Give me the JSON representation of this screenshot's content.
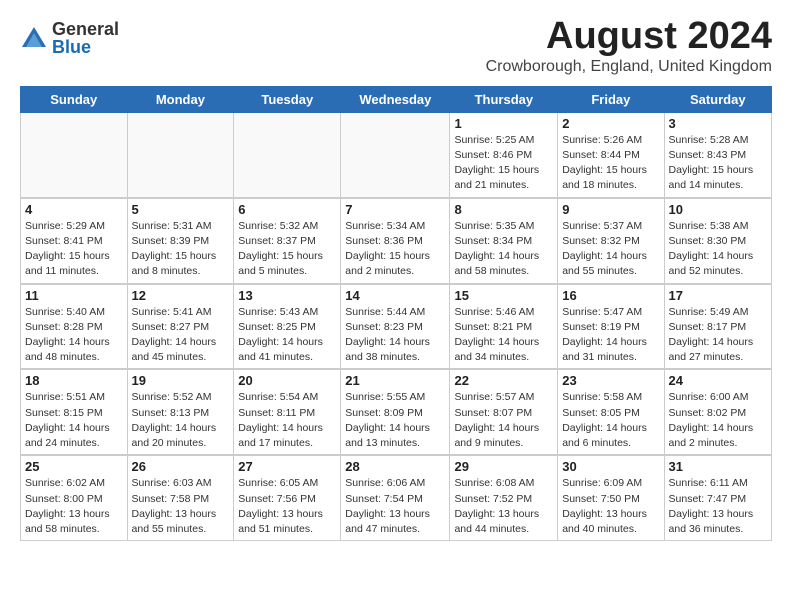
{
  "header": {
    "logo_general": "General",
    "logo_blue": "Blue",
    "month_title": "August 2024",
    "location": "Crowborough, England, United Kingdom"
  },
  "days_of_week": [
    "Sunday",
    "Monday",
    "Tuesday",
    "Wednesday",
    "Thursday",
    "Friday",
    "Saturday"
  ],
  "weeks": [
    [
      {
        "day": "",
        "info": ""
      },
      {
        "day": "",
        "info": ""
      },
      {
        "day": "",
        "info": ""
      },
      {
        "day": "",
        "info": ""
      },
      {
        "day": "1",
        "info": "Sunrise: 5:25 AM\nSunset: 8:46 PM\nDaylight: 15 hours\nand 21 minutes."
      },
      {
        "day": "2",
        "info": "Sunrise: 5:26 AM\nSunset: 8:44 PM\nDaylight: 15 hours\nand 18 minutes."
      },
      {
        "day": "3",
        "info": "Sunrise: 5:28 AM\nSunset: 8:43 PM\nDaylight: 15 hours\nand 14 minutes."
      }
    ],
    [
      {
        "day": "4",
        "info": "Sunrise: 5:29 AM\nSunset: 8:41 PM\nDaylight: 15 hours\nand 11 minutes."
      },
      {
        "day": "5",
        "info": "Sunrise: 5:31 AM\nSunset: 8:39 PM\nDaylight: 15 hours\nand 8 minutes."
      },
      {
        "day": "6",
        "info": "Sunrise: 5:32 AM\nSunset: 8:37 PM\nDaylight: 15 hours\nand 5 minutes."
      },
      {
        "day": "7",
        "info": "Sunrise: 5:34 AM\nSunset: 8:36 PM\nDaylight: 15 hours\nand 2 minutes."
      },
      {
        "day": "8",
        "info": "Sunrise: 5:35 AM\nSunset: 8:34 PM\nDaylight: 14 hours\nand 58 minutes."
      },
      {
        "day": "9",
        "info": "Sunrise: 5:37 AM\nSunset: 8:32 PM\nDaylight: 14 hours\nand 55 minutes."
      },
      {
        "day": "10",
        "info": "Sunrise: 5:38 AM\nSunset: 8:30 PM\nDaylight: 14 hours\nand 52 minutes."
      }
    ],
    [
      {
        "day": "11",
        "info": "Sunrise: 5:40 AM\nSunset: 8:28 PM\nDaylight: 14 hours\nand 48 minutes."
      },
      {
        "day": "12",
        "info": "Sunrise: 5:41 AM\nSunset: 8:27 PM\nDaylight: 14 hours\nand 45 minutes."
      },
      {
        "day": "13",
        "info": "Sunrise: 5:43 AM\nSunset: 8:25 PM\nDaylight: 14 hours\nand 41 minutes."
      },
      {
        "day": "14",
        "info": "Sunrise: 5:44 AM\nSunset: 8:23 PM\nDaylight: 14 hours\nand 38 minutes."
      },
      {
        "day": "15",
        "info": "Sunrise: 5:46 AM\nSunset: 8:21 PM\nDaylight: 14 hours\nand 34 minutes."
      },
      {
        "day": "16",
        "info": "Sunrise: 5:47 AM\nSunset: 8:19 PM\nDaylight: 14 hours\nand 31 minutes."
      },
      {
        "day": "17",
        "info": "Sunrise: 5:49 AM\nSunset: 8:17 PM\nDaylight: 14 hours\nand 27 minutes."
      }
    ],
    [
      {
        "day": "18",
        "info": "Sunrise: 5:51 AM\nSunset: 8:15 PM\nDaylight: 14 hours\nand 24 minutes."
      },
      {
        "day": "19",
        "info": "Sunrise: 5:52 AM\nSunset: 8:13 PM\nDaylight: 14 hours\nand 20 minutes."
      },
      {
        "day": "20",
        "info": "Sunrise: 5:54 AM\nSunset: 8:11 PM\nDaylight: 14 hours\nand 17 minutes."
      },
      {
        "day": "21",
        "info": "Sunrise: 5:55 AM\nSunset: 8:09 PM\nDaylight: 14 hours\nand 13 minutes."
      },
      {
        "day": "22",
        "info": "Sunrise: 5:57 AM\nSunset: 8:07 PM\nDaylight: 14 hours\nand 9 minutes."
      },
      {
        "day": "23",
        "info": "Sunrise: 5:58 AM\nSunset: 8:05 PM\nDaylight: 14 hours\nand 6 minutes."
      },
      {
        "day": "24",
        "info": "Sunrise: 6:00 AM\nSunset: 8:02 PM\nDaylight: 14 hours\nand 2 minutes."
      }
    ],
    [
      {
        "day": "25",
        "info": "Sunrise: 6:02 AM\nSunset: 8:00 PM\nDaylight: 13 hours\nand 58 minutes."
      },
      {
        "day": "26",
        "info": "Sunrise: 6:03 AM\nSunset: 7:58 PM\nDaylight: 13 hours\nand 55 minutes."
      },
      {
        "day": "27",
        "info": "Sunrise: 6:05 AM\nSunset: 7:56 PM\nDaylight: 13 hours\nand 51 minutes."
      },
      {
        "day": "28",
        "info": "Sunrise: 6:06 AM\nSunset: 7:54 PM\nDaylight: 13 hours\nand 47 minutes."
      },
      {
        "day": "29",
        "info": "Sunrise: 6:08 AM\nSunset: 7:52 PM\nDaylight: 13 hours\nand 44 minutes."
      },
      {
        "day": "30",
        "info": "Sunrise: 6:09 AM\nSunset: 7:50 PM\nDaylight: 13 hours\nand 40 minutes."
      },
      {
        "day": "31",
        "info": "Sunrise: 6:11 AM\nSunset: 7:47 PM\nDaylight: 13 hours\nand 36 minutes."
      }
    ]
  ]
}
